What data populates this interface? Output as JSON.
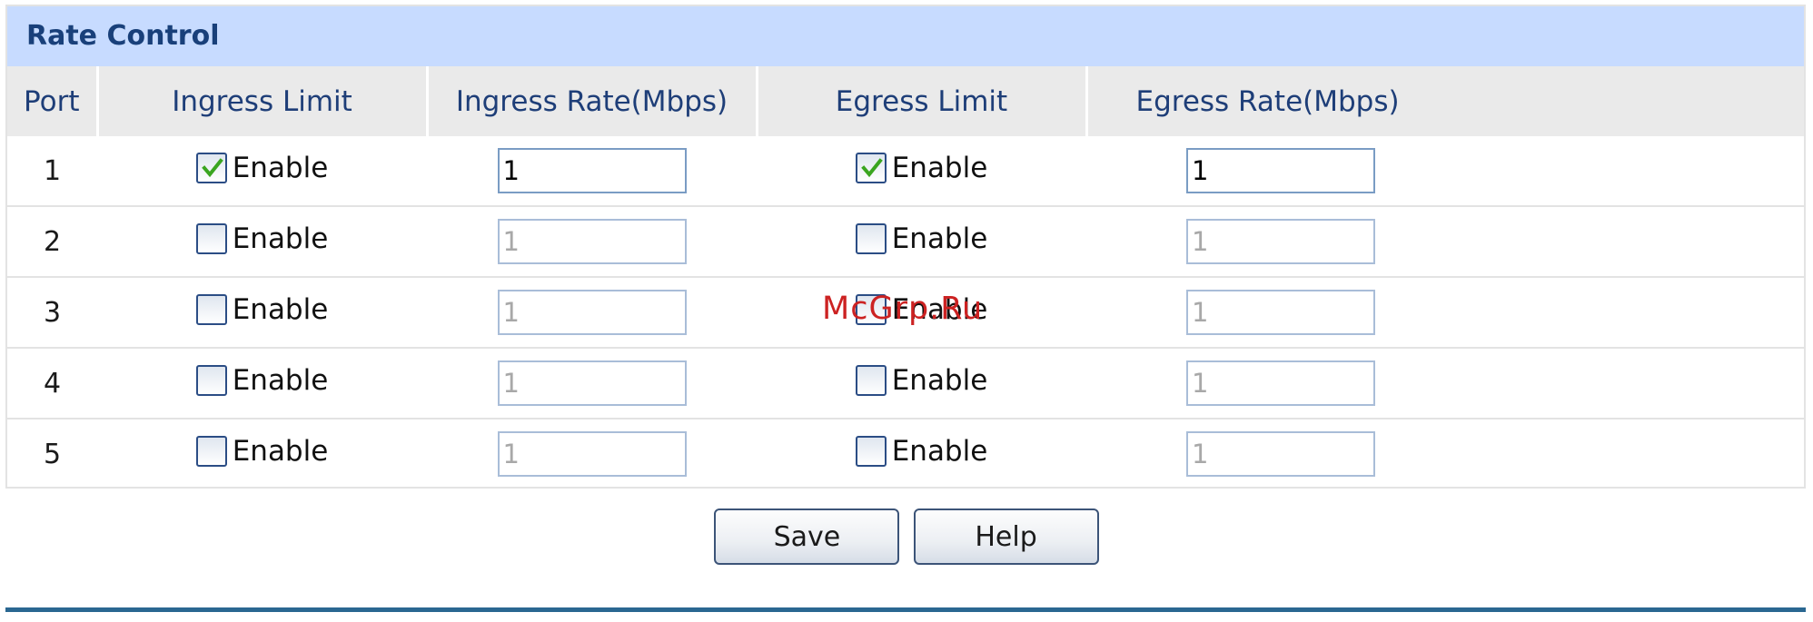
{
  "panel": {
    "title": "Rate Control"
  },
  "table": {
    "headers": [
      "Port",
      "Ingress Limit",
      "Ingress Rate(Mbps)",
      "Egress Limit",
      "Egress Rate(Mbps)"
    ],
    "rows": [
      {
        "port": "1",
        "ingress_enabled": true,
        "ingress_label": "Enable",
        "ingress_rate": "1",
        "egress_enabled": true,
        "egress_label": "Enable",
        "egress_rate": "1"
      },
      {
        "port": "2",
        "ingress_enabled": false,
        "ingress_label": "Enable",
        "ingress_rate": "1",
        "egress_enabled": false,
        "egress_label": "Enable",
        "egress_rate": "1"
      },
      {
        "port": "3",
        "ingress_enabled": false,
        "ingress_label": "Enable",
        "ingress_rate": "1",
        "egress_enabled": false,
        "egress_label": "Enable",
        "egress_rate": "1"
      },
      {
        "port": "4",
        "ingress_enabled": false,
        "ingress_label": "Enable",
        "ingress_rate": "1",
        "egress_enabled": false,
        "egress_label": "Enable",
        "egress_rate": "1"
      },
      {
        "port": "5",
        "ingress_enabled": false,
        "ingress_label": "Enable",
        "ingress_rate": "1",
        "egress_enabled": false,
        "egress_label": "Enable",
        "egress_rate": "1"
      }
    ]
  },
  "buttons": {
    "save_label": "Save",
    "help_label": "Help"
  },
  "watermark": "McGrp.Ru",
  "colors": {
    "title_bar": "#c7dbff",
    "title_text": "#19407a",
    "header_bg": "#eaeaea",
    "header_text": "#1e3e78",
    "check_green": "#3aa520",
    "bottom_rule": "#2a6791"
  }
}
